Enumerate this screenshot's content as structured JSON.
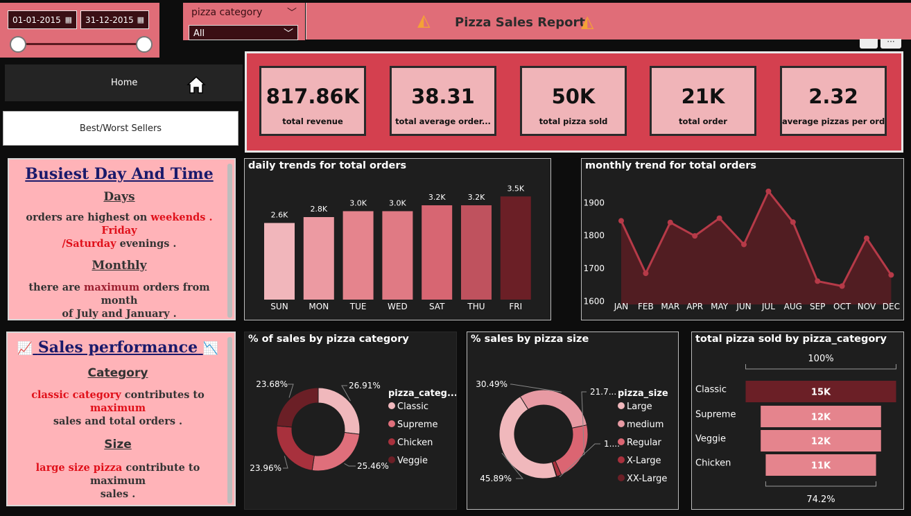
{
  "filters": {
    "start_date": "01-01-2015",
    "end_date": "31-12-2015",
    "category_label": "pizza category",
    "category_value": "All"
  },
  "report": {
    "title": "Pizza Sales Report"
  },
  "nav": {
    "home": "Home",
    "best_worst": "Best/Worst Sellers"
  },
  "notes1": {
    "title": "Busiest Day And Time",
    "days_heading": "Days",
    "days_text_1": "orders are highest on",
    "days_text_2": "weekends",
    "days_text_3": ". Friday",
    "days_text_4": "/Saturday",
    "days_text_5": "evenings .",
    "monthly_heading": "Monthly",
    "monthly_text_1": "there are",
    "monthly_text_2": "maximum",
    "monthly_text_3": "orders from month",
    "monthly_text_4": "of July and January ."
  },
  "notes2": {
    "title": "Sales performance",
    "category_heading": "Category",
    "cat_text_1": "classic category",
    "cat_text_2": "contributes to",
    "cat_text_3": "maximum",
    "cat_text_4": "sales  and total orders .",
    "size_heading": "Size",
    "size_text_1": "large size pizza",
    "size_text_2": "contribute to maximum",
    "size_text_3": "sales ."
  },
  "kpis": [
    {
      "value": "817.86K",
      "label": "total revenue"
    },
    {
      "value": "38.31",
      "label": "total average order..."
    },
    {
      "value": "50K",
      "label": "total pizza sold"
    },
    {
      "value": "21K",
      "label": "total order"
    },
    {
      "value": "2.32",
      "label": "average pizzas per order"
    }
  ],
  "chart_data": [
    {
      "type": "bar",
      "title": "daily trends for total orders",
      "categories": [
        "SUN",
        "MON",
        "TUE",
        "WED",
        "SAT",
        "THU",
        "FRI"
      ],
      "values": [
        2.6,
        2.8,
        3.0,
        3.0,
        3.2,
        3.2,
        3.5
      ],
      "data_labels": [
        "2.6K",
        "2.8K",
        "3.0K",
        "3.0K",
        "3.2K",
        "3.2K",
        "3.5K"
      ],
      "colors": [
        "#f1b6bb",
        "#ec9aa2",
        "#e5848d",
        "#e07a84",
        "#d76672",
        "#bf525e",
        "#6b1f26"
      ],
      "ylim": [
        0,
        3.6
      ]
    },
    {
      "type": "area",
      "title": "monthly trend for total orders",
      "categories": [
        "JAN",
        "FEB",
        "MAR",
        "APR",
        "MAY",
        "JUN",
        "JUL",
        "AUG",
        "SEP",
        "OCT",
        "NOV",
        "DEC"
      ],
      "values": [
        1845,
        1685,
        1840,
        1799,
        1853,
        1773,
        1935,
        1841,
        1661,
        1646,
        1792,
        1680
      ],
      "yticks": [
        1600,
        1700,
        1800,
        1900
      ],
      "ylim": [
        1590,
        1960
      ],
      "color": "#b63a48"
    },
    {
      "type": "pie",
      "title": "% of sales by pizza category",
      "legend_title": "pizza_categ...",
      "labels": [
        "Classic",
        "Supreme",
        "Chicken",
        "Veggie"
      ],
      "values": [
        26.91,
        25.46,
        23.96,
        23.68
      ],
      "value_labels": [
        "26.91%",
        "25.46%",
        "23.96%",
        "23.68%"
      ],
      "colors": [
        "#f0b8bc",
        "#df6f7b",
        "#a8313d",
        "#6b1f26"
      ]
    },
    {
      "type": "pie",
      "title": "% sales by pizza size",
      "legend_title": "pizza_size",
      "labels": [
        "Large",
        "medium",
        "Regular",
        "X-Large",
        "XX-Large"
      ],
      "values": [
        45.89,
        30.49,
        21.77,
        1.72,
        0.12
      ],
      "value_labels": [
        "45.89%",
        "30.49%",
        "21.7...",
        "1....",
        ""
      ],
      "colors": [
        "#f0b8bc",
        "#e79aa3",
        "#db6572",
        "#a8313d",
        "#6b1f26"
      ]
    },
    {
      "type": "bar",
      "title": "total pizza sold by pizza_category",
      "orientation": "funnel",
      "categories": [
        "Classic",
        "Supreme",
        "Veggie",
        "Chicken"
      ],
      "values": [
        15,
        12,
        12,
        11
      ],
      "data_labels": [
        "15K",
        "12K",
        "12K",
        "11K"
      ],
      "top_label": "100%",
      "bottom_label": "74.2%",
      "colors": [
        "#6b1f26",
        "#e5848d",
        "#e5848d",
        "#e5848d"
      ]
    }
  ]
}
